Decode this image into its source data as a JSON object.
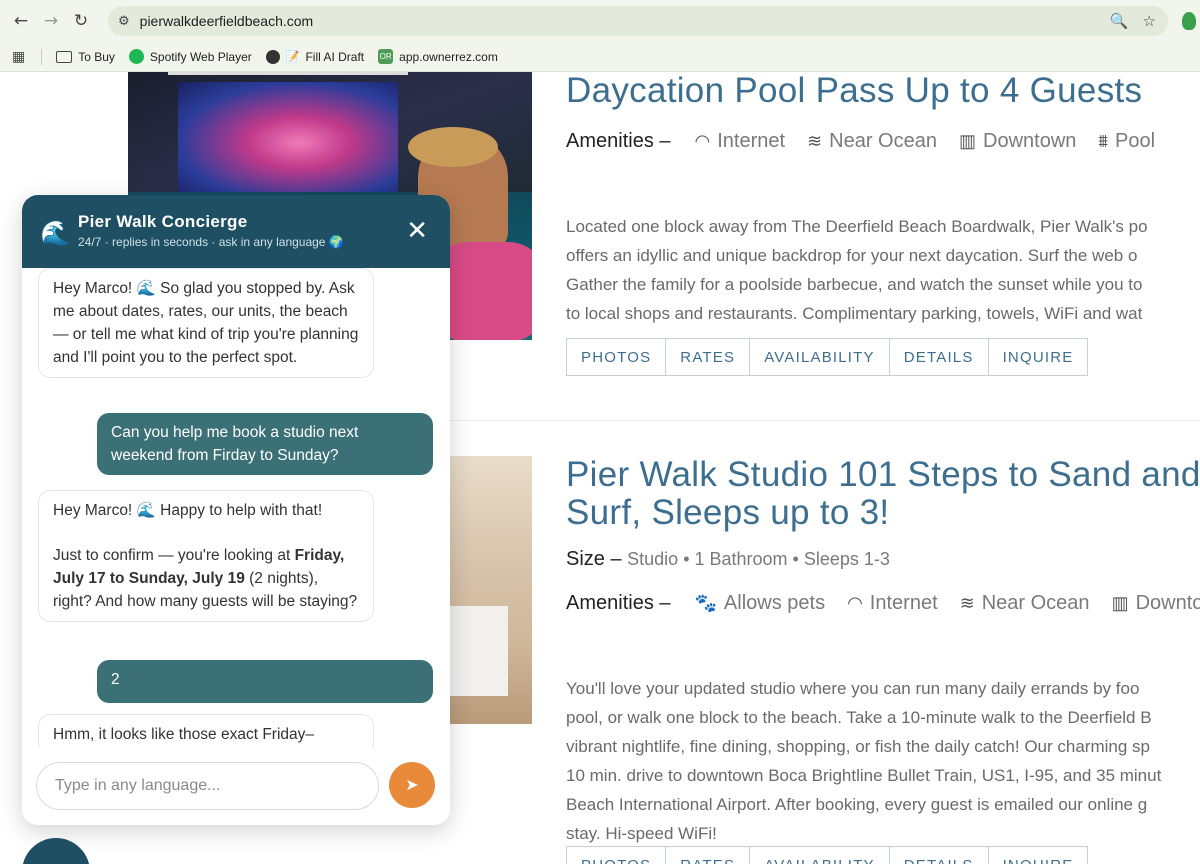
{
  "browser": {
    "url": "pierwalkdeerfieldbeach.com",
    "bookmarks": [
      {
        "label": "To Buy",
        "icon": "folder-icon"
      },
      {
        "label": "Spotify Web Player",
        "icon": "spotify-icon"
      },
      {
        "label": "Fill AI Draft",
        "icon": "globe-icon"
      },
      {
        "label": "app.ownerrez.com",
        "icon": "ownerrez-icon"
      }
    ]
  },
  "listing1": {
    "title": "Daycation Pool Pass Up to 4 Guests",
    "amenities_label": "Amenities –",
    "amenities": [
      "Internet",
      "Near Ocean",
      "Downtown",
      "Pool"
    ],
    "desc": [
      "Located one block away from The Deerfield Beach Boardwalk, Pier Walk's po",
      "offers an idyllic and unique backdrop for your next daycation. Surf the web o",
      "Gather the family for a poolside barbecue, and watch the sunset while you to",
      "to local shops and restaurants. Complimentary parking, towels, WiFi and wat"
    ],
    "buttons": [
      "PHOTOS",
      "RATES",
      "AVAILABILITY",
      "DETAILS",
      "INQUIRE"
    ]
  },
  "listing2": {
    "title_line1": "Pier Walk Studio 101 Steps to Sand and",
    "title_line2": "Surf, Sleeps up to 3!",
    "size_label": "Size –",
    "size_value": "Studio • 1 Bathroom • Sleeps 1-3",
    "amenities_label": "Amenities –",
    "amenities": [
      "Allows pets",
      "Internet",
      "Near Ocean",
      "Downtown"
    ],
    "desc": [
      "You'll love your updated studio where you can run many daily errands by foo",
      "pool, or walk one block to the beach. Take a 10-minute walk to the Deerfield B",
      "vibrant nightlife, fine dining, shopping, or fish the daily catch! Our charming sp",
      "10 min. drive to downtown Boca Brightline Bullet Train, US1, I-95, and 35 minut",
      "Beach International Airport. After booking, every guest is emailed our online g",
      "stay. Hi-speed WiFi!"
    ],
    "buttons": [
      "PHOTOS",
      "RATES",
      "AVAILABILITY",
      "DETAILS",
      "INQUIRE"
    ]
  },
  "chat": {
    "title": "Pier Walk Concierge",
    "subtitle": "24/7 · replies in seconds · ask in any language 🌍",
    "messages": [
      {
        "from": "bot",
        "text": "Hey Marco! 🌊 So glad you stopped by. Ask me about dates, rates, our units, the beach — or tell me what kind of trip you're planning and I'll point you to the perfect spot."
      },
      {
        "from": "user",
        "text": "Can you help me book a studio next weekend from Firday to Sunday?"
      },
      {
        "from": "bot",
        "line1": "Hey Marco! 🌊 Happy to help with that!",
        "line2_pre": "Just to confirm — you're looking at ",
        "line2_bold": "Friday, July 17 to Sunday, July 19",
        "line2_post": " (2 nights), right? And how many guests will be staying?"
      },
      {
        "from": "user",
        "text": "2"
      },
      {
        "from": "bot",
        "text": "Hmm, it looks like those exact Friday–"
      }
    ],
    "input_placeholder": "Type in any language..."
  }
}
